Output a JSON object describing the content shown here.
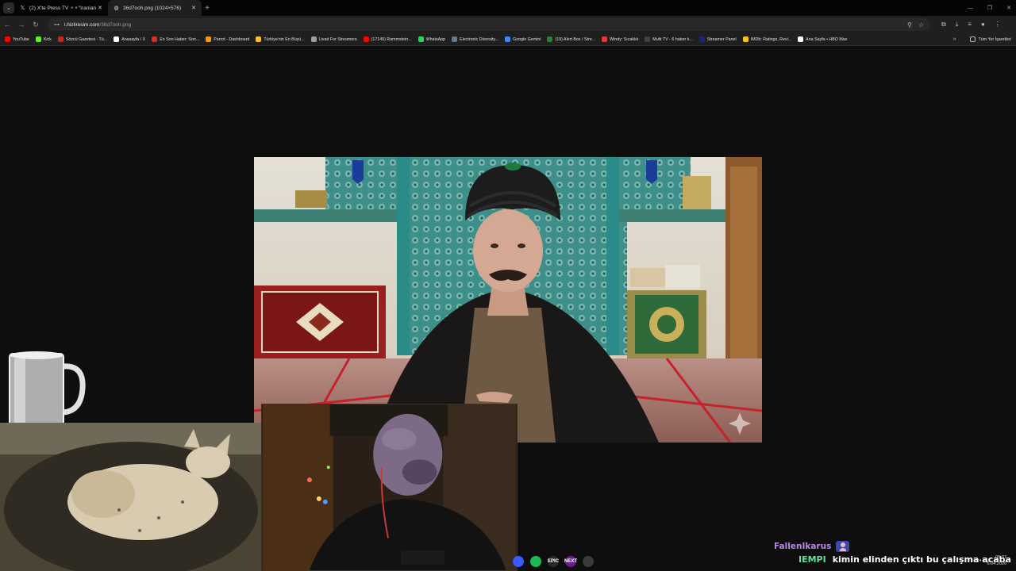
{
  "tabs": [
    {
      "icon": "x-logo-icon",
      "title": "(2) X'te Press TV ⚬⚬\"Iranian m",
      "active": false
    },
    {
      "icon": "globe-icon",
      "title": "36d7ooh.png (1024×576)",
      "active": true
    }
  ],
  "toolbar": {
    "url_host": "i.hizliresim.com",
    "url_path": "/36d7ooh.png"
  },
  "bookmarks": [
    {
      "label": "YouTube",
      "color": "#ff0000"
    },
    {
      "label": "Kick",
      "color": "#53fc18"
    },
    {
      "label": "Sözcü Gazetesi - Tü...",
      "color": "#c62828"
    },
    {
      "label": "Anasayfa / X",
      "color": "#ffffff"
    },
    {
      "label": "En Son Haber: Son...",
      "color": "#d32f2f"
    },
    {
      "label": "Parrot - Dashboard",
      "color": "#ff9800"
    },
    {
      "label": "Türkiye'nin En Büyü...",
      "color": "#fbc02d"
    },
    {
      "label": "Livad For Streamers",
      "color": "#9e9e9e"
    },
    {
      "label": "(17145) Rammstein...",
      "color": "#ff0000"
    },
    {
      "label": "WhatsApp",
      "color": "#25d366"
    },
    {
      "label": "Electronic Diversity...",
      "color": "#607d8b"
    },
    {
      "label": "Google Gemini",
      "color": "#4285f4"
    },
    {
      "label": "(19) Alert Box / Stre...",
      "color": "#2e7d32"
    },
    {
      "label": "Windy: Sıcaklık",
      "color": "#e53935"
    },
    {
      "label": "Multi TV - 6 haber k...",
      "color": "#424242"
    },
    {
      "label": "Streamer Panel",
      "color": "#1a237e"
    },
    {
      "label": "IMDb: Ratings, Revi...",
      "color": "#f5c518"
    },
    {
      "label": "Ana Sayfa • HBO Max",
      "color": "#ffffff"
    }
  ],
  "bookmarks_folder": "Tüm Yer İşaretleri",
  "chat": {
    "follower_name": "FallenIkarus",
    "message_user": "IEMPI",
    "message_text": "kimin elinden çıktı bu çalışma acaba"
  },
  "clock": {
    "time": "05:37",
    "date": "6.04.2026"
  },
  "taskbar_apps": [
    {
      "name": "spotify-icon",
      "label": "",
      "color": "#1db954"
    },
    {
      "name": "epic-games-icon",
      "label": "EPIC",
      "color": "#2a2a2a"
    },
    {
      "name": "next-app-icon",
      "label": "NEXT",
      "color": "#6a1b9a"
    },
    {
      "name": "obs-icon",
      "label": "",
      "color": "#3a3a3a"
    }
  ]
}
